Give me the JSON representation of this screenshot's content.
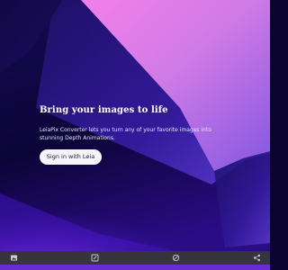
{
  "hero": {
    "headline": "Bring your images to life",
    "description": "LeiaPix Converter lets you turn any of your favorite images into stunning Depth Animations.",
    "signin_label": "Sign in with Leia"
  },
  "toolbar": {
    "tools": [
      {
        "icon": "gallery-icon"
      },
      {
        "icon": "edit-icon"
      },
      {
        "icon": "no-sign-icon"
      },
      {
        "icon": "share-icon"
      }
    ]
  },
  "colors": {
    "background_dark": "#0b0430",
    "background_purple": "#5a1ad6",
    "highlight_pink": "#f2a0ef",
    "button_bg": "#f6f4fb",
    "toolbar_bg": "#37343c"
  }
}
